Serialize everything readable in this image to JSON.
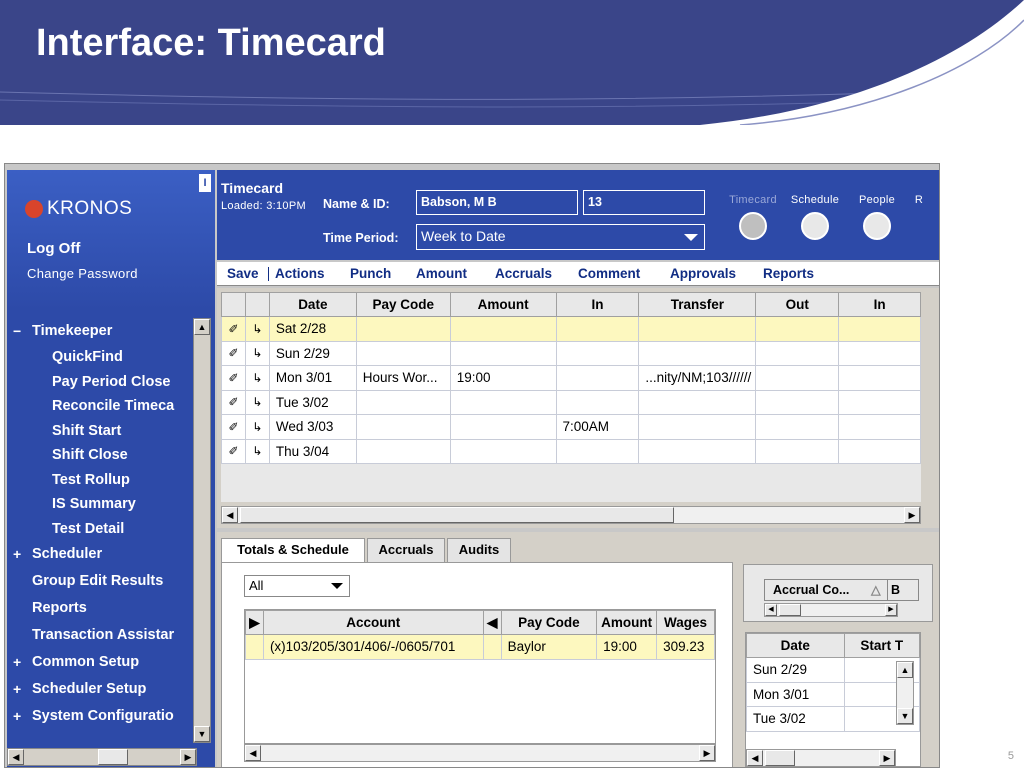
{
  "slide": {
    "title": "Interface: Timecard",
    "page_number": "5"
  },
  "sidebar": {
    "logo_text": "KRONOS",
    "corner_tag": "I",
    "log_off": "Log Off",
    "change_password": "Change Password",
    "items": [
      {
        "prefix": "−",
        "label": "Timekeeper",
        "level": 0
      },
      {
        "prefix": "",
        "label": "QuickFind",
        "level": 1
      },
      {
        "prefix": "",
        "label": "Pay Period Close",
        "level": 1
      },
      {
        "prefix": "",
        "label": "Reconcile Timeca",
        "level": 1
      },
      {
        "prefix": "",
        "label": "Shift Start",
        "level": 1
      },
      {
        "prefix": "",
        "label": "Shift Close",
        "level": 1
      },
      {
        "prefix": "",
        "label": "Test Rollup",
        "level": 1
      },
      {
        "prefix": "",
        "label": "IS Summary",
        "level": 1
      },
      {
        "prefix": "",
        "label": "Test Detail",
        "level": 1
      },
      {
        "prefix": "+",
        "label": "Scheduler",
        "level": 0
      },
      {
        "prefix": "",
        "label": "Group Edit Results",
        "level": 0
      },
      {
        "prefix": "",
        "label": "Reports",
        "level": 0
      },
      {
        "prefix": "",
        "label": "Transaction Assistar",
        "level": 0
      },
      {
        "prefix": "+",
        "label": "Common Setup",
        "level": 0
      },
      {
        "prefix": "+",
        "label": "Scheduler Setup",
        "level": 0
      },
      {
        "prefix": "+",
        "label": "System Configuratio",
        "level": 0
      }
    ]
  },
  "header": {
    "title": "Timecard",
    "loaded": "Loaded: 3:10PM",
    "name_label": "Name & ID:",
    "name_value": "Babson, M B",
    "id_value": "13",
    "period_label": "Time Period:",
    "period_value": "Week to Date",
    "nav": [
      {
        "label": "Timecard",
        "icon": "clock-icon",
        "active": true
      },
      {
        "label": "Schedule",
        "icon": "calendar-icon",
        "active": false
      },
      {
        "label": "People",
        "icon": "person-icon",
        "active": false
      },
      {
        "label": "R",
        "icon": "reports-icon",
        "active": false
      }
    ]
  },
  "menu": [
    "Save",
    "Actions",
    "Punch",
    "Amount",
    "Accruals",
    "Comment",
    "Approvals",
    "Reports"
  ],
  "timecard": {
    "columns": [
      "",
      "",
      "Date",
      "Pay Code",
      "Amount",
      "In",
      "Transfer",
      "Out",
      "In"
    ],
    "rows": [
      {
        "date": "Sat 2/28",
        "pay_code": "",
        "amount": "",
        "in": "",
        "transfer": "",
        "out": "",
        "in2": "",
        "selected": true
      },
      {
        "date": "Sun 2/29",
        "pay_code": "",
        "amount": "",
        "in": "",
        "transfer": "",
        "out": "",
        "in2": "",
        "selected": false
      },
      {
        "date": "Mon 3/01",
        "pay_code": "Hours Wor...",
        "amount": "19:00",
        "in": "",
        "transfer": "...nity/NM;103//////",
        "out": "",
        "in2": "",
        "selected": false
      },
      {
        "date": "Tue 3/02",
        "pay_code": "",
        "amount": "",
        "in": "",
        "transfer": "",
        "out": "",
        "in2": "",
        "selected": false
      },
      {
        "date": "Wed 3/03",
        "pay_code": "",
        "amount": "",
        "in": "7:00AM",
        "transfer": "",
        "out": "",
        "in2": "",
        "selected": false
      },
      {
        "date": "Thu 3/04",
        "pay_code": "",
        "amount": "",
        "in": "",
        "transfer": "",
        "out": "",
        "in2": "",
        "selected": false
      }
    ]
  },
  "tabs": [
    "Totals & Schedule",
    "Accruals",
    "Audits"
  ],
  "totals": {
    "filter_value": "All",
    "columns": [
      "Account",
      "Pay Code",
      "Amount",
      "Wages"
    ],
    "rows": [
      {
        "account": "(x)103/205/301/406/-/0605/701",
        "pay_code": "Baylor",
        "amount": "19:00",
        "wages": "309.23"
      }
    ]
  },
  "accrual": {
    "column": "Accrual Co...",
    "column2": "B"
  },
  "schedule": {
    "columns": [
      "Date",
      "Start T"
    ],
    "rows": [
      "Sun 2/29",
      "Mon 3/01",
      "Tue 3/02"
    ]
  },
  "colors": {
    "brand_blue": "#2d4aa8",
    "link_blue": "#112d84",
    "selected_row": "#fdf8bf",
    "header_bg": "#3a4589"
  }
}
